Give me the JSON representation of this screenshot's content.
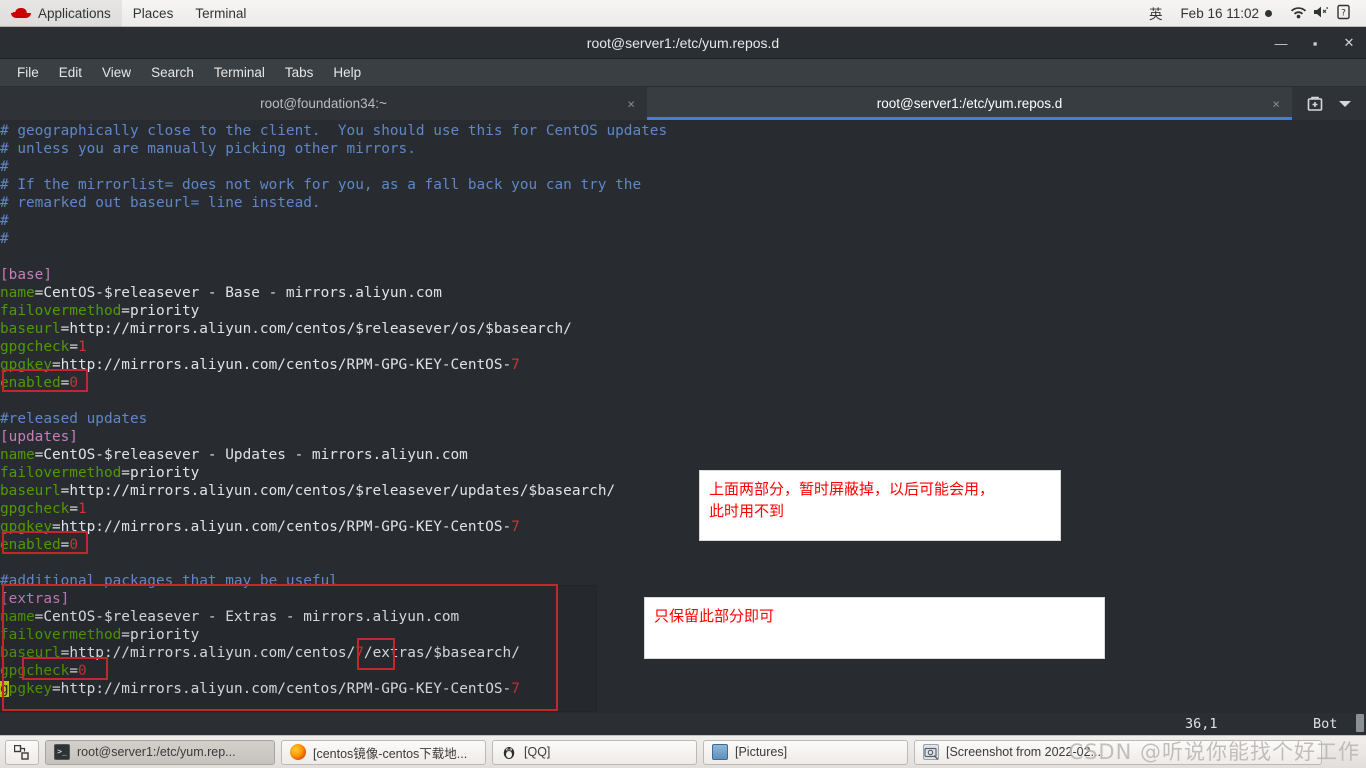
{
  "top_panel": {
    "logo_name": "red-hat-logo",
    "menus": [
      "Applications",
      "Places",
      "Terminal"
    ],
    "ime": "英",
    "clock": "Feb 16  11:02",
    "indicators": [
      "recording-dot",
      "wifi-icon",
      "volume-muted-icon",
      "battery-unknown-icon"
    ]
  },
  "window": {
    "title": "root@server1:/etc/yum.repos.d",
    "controls": {
      "minimize": "—",
      "maximize": "▪",
      "close": "✕"
    }
  },
  "menu_bar": [
    "File",
    "Edit",
    "View",
    "Search",
    "Terminal",
    "Tabs",
    "Help"
  ],
  "tabs": [
    {
      "label": "root@foundation34:~",
      "close": "×",
      "active": false
    },
    {
      "label": "root@server1:/etc/yum.repos.d",
      "close": "×",
      "active": true
    }
  ],
  "tab_actions": {
    "new_tab": "new-tab-icon",
    "tab_list": "chevron-down-icon"
  },
  "terminal": {
    "lines": [
      [
        {
          "t": "# geographically close to the client.  You should use this for CentOS updates",
          "c": "c-com"
        }
      ],
      [
        {
          "t": "# unless you are manually picking other mirrors.",
          "c": "c-com"
        }
      ],
      [
        {
          "t": "#",
          "c": "c-com"
        }
      ],
      [
        {
          "t": "# If the mirrorlist= does not work for you, as a fall back you can try the",
          "c": "c-com"
        }
      ],
      [
        {
          "t": "# remarked out baseurl= line instead.",
          "c": "c-com"
        }
      ],
      [
        {
          "t": "#",
          "c": "c-com"
        }
      ],
      [
        {
          "t": "#",
          "c": "c-com"
        }
      ],
      [
        {
          "t": "",
          "c": "c-val"
        }
      ],
      [
        {
          "t": "[base]",
          "c": "c-sec"
        }
      ],
      [
        {
          "t": "name",
          "c": "c-key"
        },
        {
          "t": "=CentOS-$releasever - Base - mirrors.aliyun.com",
          "c": "c-val"
        }
      ],
      [
        {
          "t": "failovermethod",
          "c": "c-key"
        },
        {
          "t": "=priority",
          "c": "c-val"
        }
      ],
      [
        {
          "t": "baseurl",
          "c": "c-key"
        },
        {
          "t": "=http://mirrors.aliyun.com/centos/$releasever/os/$basearch/",
          "c": "c-val"
        }
      ],
      [
        {
          "t": "gpgcheck",
          "c": "c-key"
        },
        {
          "t": "=",
          "c": "c-val"
        },
        {
          "t": "1",
          "c": "c-num"
        }
      ],
      [
        {
          "t": "gpgkey",
          "c": "c-key"
        },
        {
          "t": "=http://mirrors.aliyun.com/centos/RPM-GPG-KEY-CentOS-",
          "c": "c-val"
        },
        {
          "t": "7",
          "c": "c-num"
        }
      ],
      [
        {
          "t": "enabled",
          "c": "c-key"
        },
        {
          "t": "=",
          "c": "c-val"
        },
        {
          "t": "0",
          "c": "c-num"
        }
      ],
      [
        {
          "t": "",
          "c": "c-val"
        }
      ],
      [
        {
          "t": "#released updates",
          "c": "c-com"
        }
      ],
      [
        {
          "t": "[updates]",
          "c": "c-sec"
        }
      ],
      [
        {
          "t": "name",
          "c": "c-key"
        },
        {
          "t": "=CentOS-$releasever - Updates - mirrors.aliyun.com",
          "c": "c-val"
        }
      ],
      [
        {
          "t": "failovermethod",
          "c": "c-key"
        },
        {
          "t": "=priority",
          "c": "c-val"
        }
      ],
      [
        {
          "t": "baseurl",
          "c": "c-key"
        },
        {
          "t": "=http://mirrors.aliyun.com/centos/$releasever/updates/$basearch/",
          "c": "c-val"
        }
      ],
      [
        {
          "t": "gpgcheck",
          "c": "c-key"
        },
        {
          "t": "=",
          "c": "c-val"
        },
        {
          "t": "1",
          "c": "c-num"
        }
      ],
      [
        {
          "t": "gpgkey",
          "c": "c-key"
        },
        {
          "t": "=http://mirrors.aliyun.com/centos/RPM-GPG-KEY-CentOS-",
          "c": "c-val"
        },
        {
          "t": "7",
          "c": "c-num"
        }
      ],
      [
        {
          "t": "enabled",
          "c": "c-key"
        },
        {
          "t": "=",
          "c": "c-val"
        },
        {
          "t": "0",
          "c": "c-num"
        }
      ],
      [
        {
          "t": "",
          "c": "c-val"
        }
      ],
      [
        {
          "t": "#additional packages that may be useful",
          "c": "c-com"
        }
      ],
      [
        {
          "t": "[extras]",
          "c": "c-sec"
        }
      ],
      [
        {
          "t": "name",
          "c": "c-key"
        },
        {
          "t": "=CentOS-$releasever - Extras - mirrors.aliyun.com",
          "c": "c-val"
        }
      ],
      [
        {
          "t": "failovermethod",
          "c": "c-key"
        },
        {
          "t": "=priority",
          "c": "c-val"
        }
      ],
      [
        {
          "t": "baseurl",
          "c": "c-key"
        },
        {
          "t": "=http://mirrors.aliyun.com/centos/",
          "c": "c-val"
        },
        {
          "t": "7",
          "c": "c-num"
        },
        {
          "t": "/extras/$basearch/",
          "c": "c-val"
        }
      ],
      [
        {
          "t": "gpgcheck",
          "c": "c-key"
        },
        {
          "t": "=",
          "c": "c-val"
        },
        {
          "t": "0",
          "c": "c-num"
        }
      ],
      [
        {
          "t": "g",
          "c": "cursor"
        },
        {
          "t": "pgkey",
          "c": "c-key"
        },
        {
          "t": "=http://mirrors.aliyun.com/centos/RPM-GPG-KEY-CentOS-",
          "c": "c-val"
        },
        {
          "t": "7",
          "c": "c-num"
        }
      ]
    ],
    "status": {
      "position": "36,1",
      "relative": "Bot"
    }
  },
  "annotations": {
    "note1": "上面两部分，暂时屏蔽掉，以后可能会用，\n此时用不到",
    "note2": "只保留此部分即可",
    "box_color": "#c1272d"
  },
  "taskbar": {
    "switcher": "window-switcher-icon",
    "buttons": [
      {
        "label": "root@server1:/etc/yum.rep...",
        "icon": "terminal-icon",
        "active": true
      },
      {
        "label": "[centos镜像-centos下载地...",
        "icon": "firefox-icon",
        "active": false
      },
      {
        "label": "[QQ]",
        "icon": "qq-penguin-icon",
        "active": false
      },
      {
        "label": "[Pictures]",
        "icon": "pictures-folder-icon",
        "active": false
      },
      {
        "label": "[Screenshot from 2022-02...",
        "icon": "screenshot-icon",
        "active": false
      }
    ],
    "watermark": "CSDN @听说你能找个好工作"
  }
}
